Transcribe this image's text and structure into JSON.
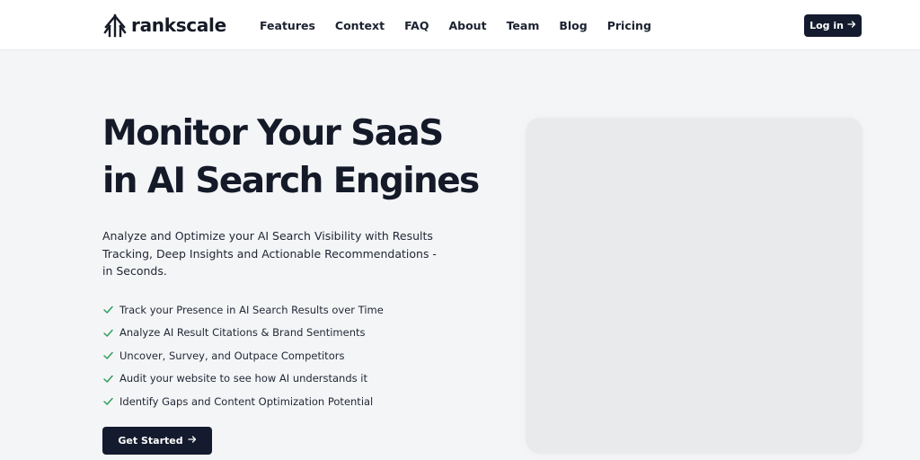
{
  "brand": {
    "name": "rankscale",
    "icon": "tree-arrows-logo-icon"
  },
  "nav": {
    "items": [
      "Features",
      "Context",
      "FAQ",
      "About",
      "Team",
      "Blog",
      "Pricing"
    ]
  },
  "header": {
    "login_label": "Log in",
    "login_icon": "arrow-right-icon"
  },
  "hero": {
    "title_line1": "Monitor Your SaaS",
    "title_line2": "in AI Search Engines",
    "subtitle": "Analyze and Optimize your AI Search Visibility with Results Tracking, Deep Insights and Actionable Recommendations - in Seconds.",
    "features": [
      "Track your Presence in AI Search Results over Time",
      "Analyze AI Result Citations & Brand Sentiments",
      "Uncover, Survey, and Outpace Competitors",
      "Audit your website to see how AI understands it",
      "Identify Gaps and Content Optimization Potential"
    ],
    "feature_icon": "check-icon",
    "cta_label": "Get Started",
    "cta_icon": "arrow-right-icon"
  },
  "colors": {
    "background": "#f4f5f7",
    "header_bg": "#ffffff",
    "primary_dark": "#141b2e",
    "check_green": "#2e9e5b",
    "placeholder": "#e9eaec"
  }
}
